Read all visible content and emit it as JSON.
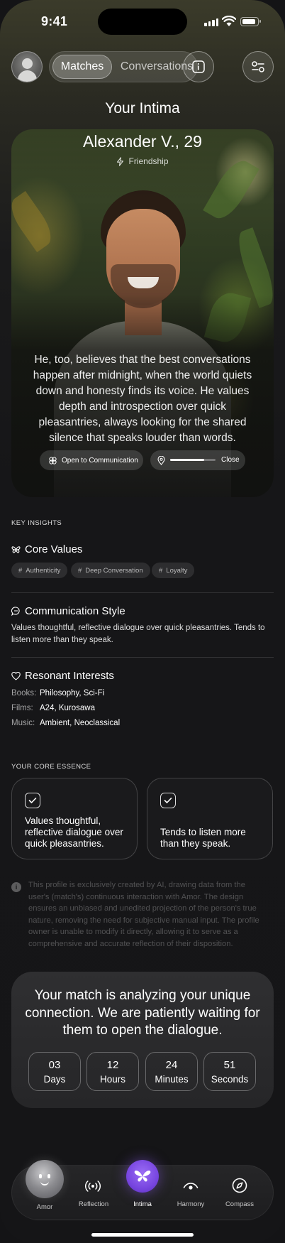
{
  "status_bar": {
    "time": "9:41"
  },
  "header": {
    "tabs": [
      {
        "label": "Matches",
        "active": true
      },
      {
        "label": "Conversations",
        "active": false
      }
    ],
    "title": "Your Intima"
  },
  "profile": {
    "name": "Alexander V., 29",
    "relationship_type": "Friendship",
    "bio": "He, too, believes that the best conversations happen after midnight, when the world quiets down and honesty finds its voice. He values depth and introspection over quick pleasantries, always looking for the shared silence that speaks louder than words.",
    "communication_label": "Open to Communication",
    "distance_label": "Close",
    "distance_level": 0.75
  },
  "insights": {
    "section_label": "KEY INSIGHTS",
    "core_values": {
      "title": "Core Values",
      "tags": [
        "Authenticity",
        "Deep Conversation",
        "Loyalty"
      ]
    },
    "communication_style": {
      "title": "Communication Style",
      "text": "Values  thoughtful, reflective dialogue over quick pleasantries. Tends to listen more than they  speak."
    },
    "resonant_interests": {
      "title": "Resonant Interests",
      "rows": [
        {
          "label": "Books:",
          "value": "Philosophy, Sci-Fi"
        },
        {
          "label": "Films:",
          "value": "A24, Kurosawa"
        },
        {
          "label": "Music:",
          "value": "Ambient, Neoclassical"
        }
      ]
    }
  },
  "essence": {
    "section_label": "YOUR CORE ESSENCE",
    "cards": [
      {
        "text": "Values  thoughtful, reflective dialogue over quick pleasantries."
      },
      {
        "text": "Tends to listen more than they  speak."
      }
    ]
  },
  "disclaimer": "This profile is exclusively created by AI, drawing data from the user's (match's) continuous interaction with Amor. The design ensures an unbiased and unedited projection of the person's true nature, removing the need for subjective manual input. The profile owner is unable to modify it directly, allowing it to serve as a comprehensive and accurate reflection of their disposition.",
  "waiting": {
    "title": "Your match is analyzing your unique connection. We are patiently waiting for them to open the dialogue.",
    "countdown": [
      {
        "value": "03",
        "unit": "Days"
      },
      {
        "value": "12",
        "unit": "Hours"
      },
      {
        "value": "24",
        "unit": "Minutes"
      },
      {
        "value": "51",
        "unit": "Seconds"
      }
    ]
  },
  "tabbar": {
    "items": [
      {
        "label": "Amor",
        "icon": "amor-face-icon"
      },
      {
        "label": "Reflection",
        "icon": "broadcast-icon"
      },
      {
        "label": "Intima",
        "icon": "butterfly-icon",
        "active": true
      },
      {
        "label": "Harmony",
        "icon": "eye-icon"
      },
      {
        "label": "Compass",
        "icon": "compass-icon"
      }
    ],
    "accent": "#7846e0"
  }
}
